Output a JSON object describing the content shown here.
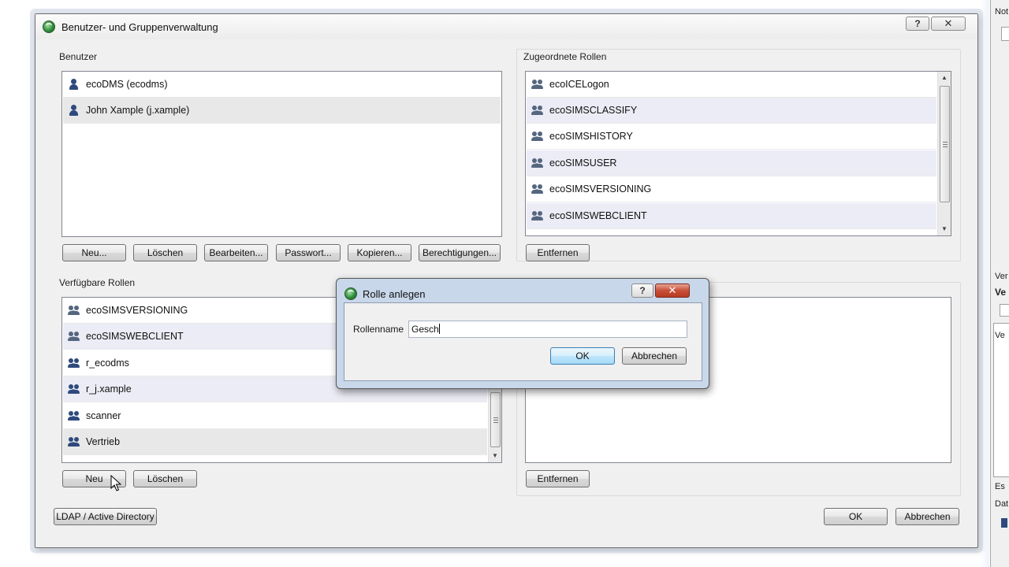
{
  "background": {
    "labels": [
      "Not",
      "Ver",
      "Ve",
      "Ve",
      "Es",
      "Dat"
    ]
  },
  "main_dialog": {
    "title": "Benutzer- und Gruppenverwaltung",
    "help_label": "?",
    "close_label": "✕",
    "users": {
      "label": "Benutzer",
      "items": [
        {
          "name": "ecoDMS (ecodms)"
        },
        {
          "name": "John Xample (j.xample)"
        }
      ],
      "buttons": {
        "new": "Neu...",
        "delete": "Löschen",
        "edit": "Bearbeiten...",
        "password": "Passwort...",
        "copy": "Kopieren...",
        "permissions": "Berechtigungen..."
      }
    },
    "assigned_roles": {
      "label": "Zugeordnete Rollen",
      "items": [
        {
          "name": "ecoICELogon"
        },
        {
          "name": "ecoSIMSCLASSIFY"
        },
        {
          "name": "ecoSIMSHISTORY"
        },
        {
          "name": "ecoSIMSUSER"
        },
        {
          "name": "ecoSIMSVERSIONING"
        },
        {
          "name": "ecoSIMSWEBCLIENT"
        }
      ],
      "remove_label": "Entfernen"
    },
    "available_roles": {
      "label": "Verfügbare Rollen",
      "items": [
        {
          "name": "ecoSIMSVERSIONING"
        },
        {
          "name": "ecoSIMSWEBCLIENT"
        },
        {
          "name": "r_ecodms"
        },
        {
          "name": "r_j.xample"
        },
        {
          "name": "scanner"
        },
        {
          "name": "Vertrieb"
        }
      ],
      "buttons": {
        "new": "Neu",
        "delete": "Löschen"
      }
    },
    "assigned_users": {
      "remove_label": "Entfernen"
    },
    "ldap_label": "LDAP / Active Directory",
    "ok_label": "OK",
    "cancel_label": "Abbrechen"
  },
  "sub_dialog": {
    "title": "Rolle anlegen",
    "help_label": "?",
    "close_label": "✕",
    "field_label": "Rollenname",
    "field_value": "Gesch",
    "ok_label": "OK",
    "cancel_label": "Abbrechen"
  },
  "colors": {
    "dialog_bg": "#f0f0f0",
    "row_alt": "#ececf6",
    "icon_blue": "#2e4a7d",
    "close_red": "#c84f37",
    "default_btn_border": "#3c7fb1"
  }
}
